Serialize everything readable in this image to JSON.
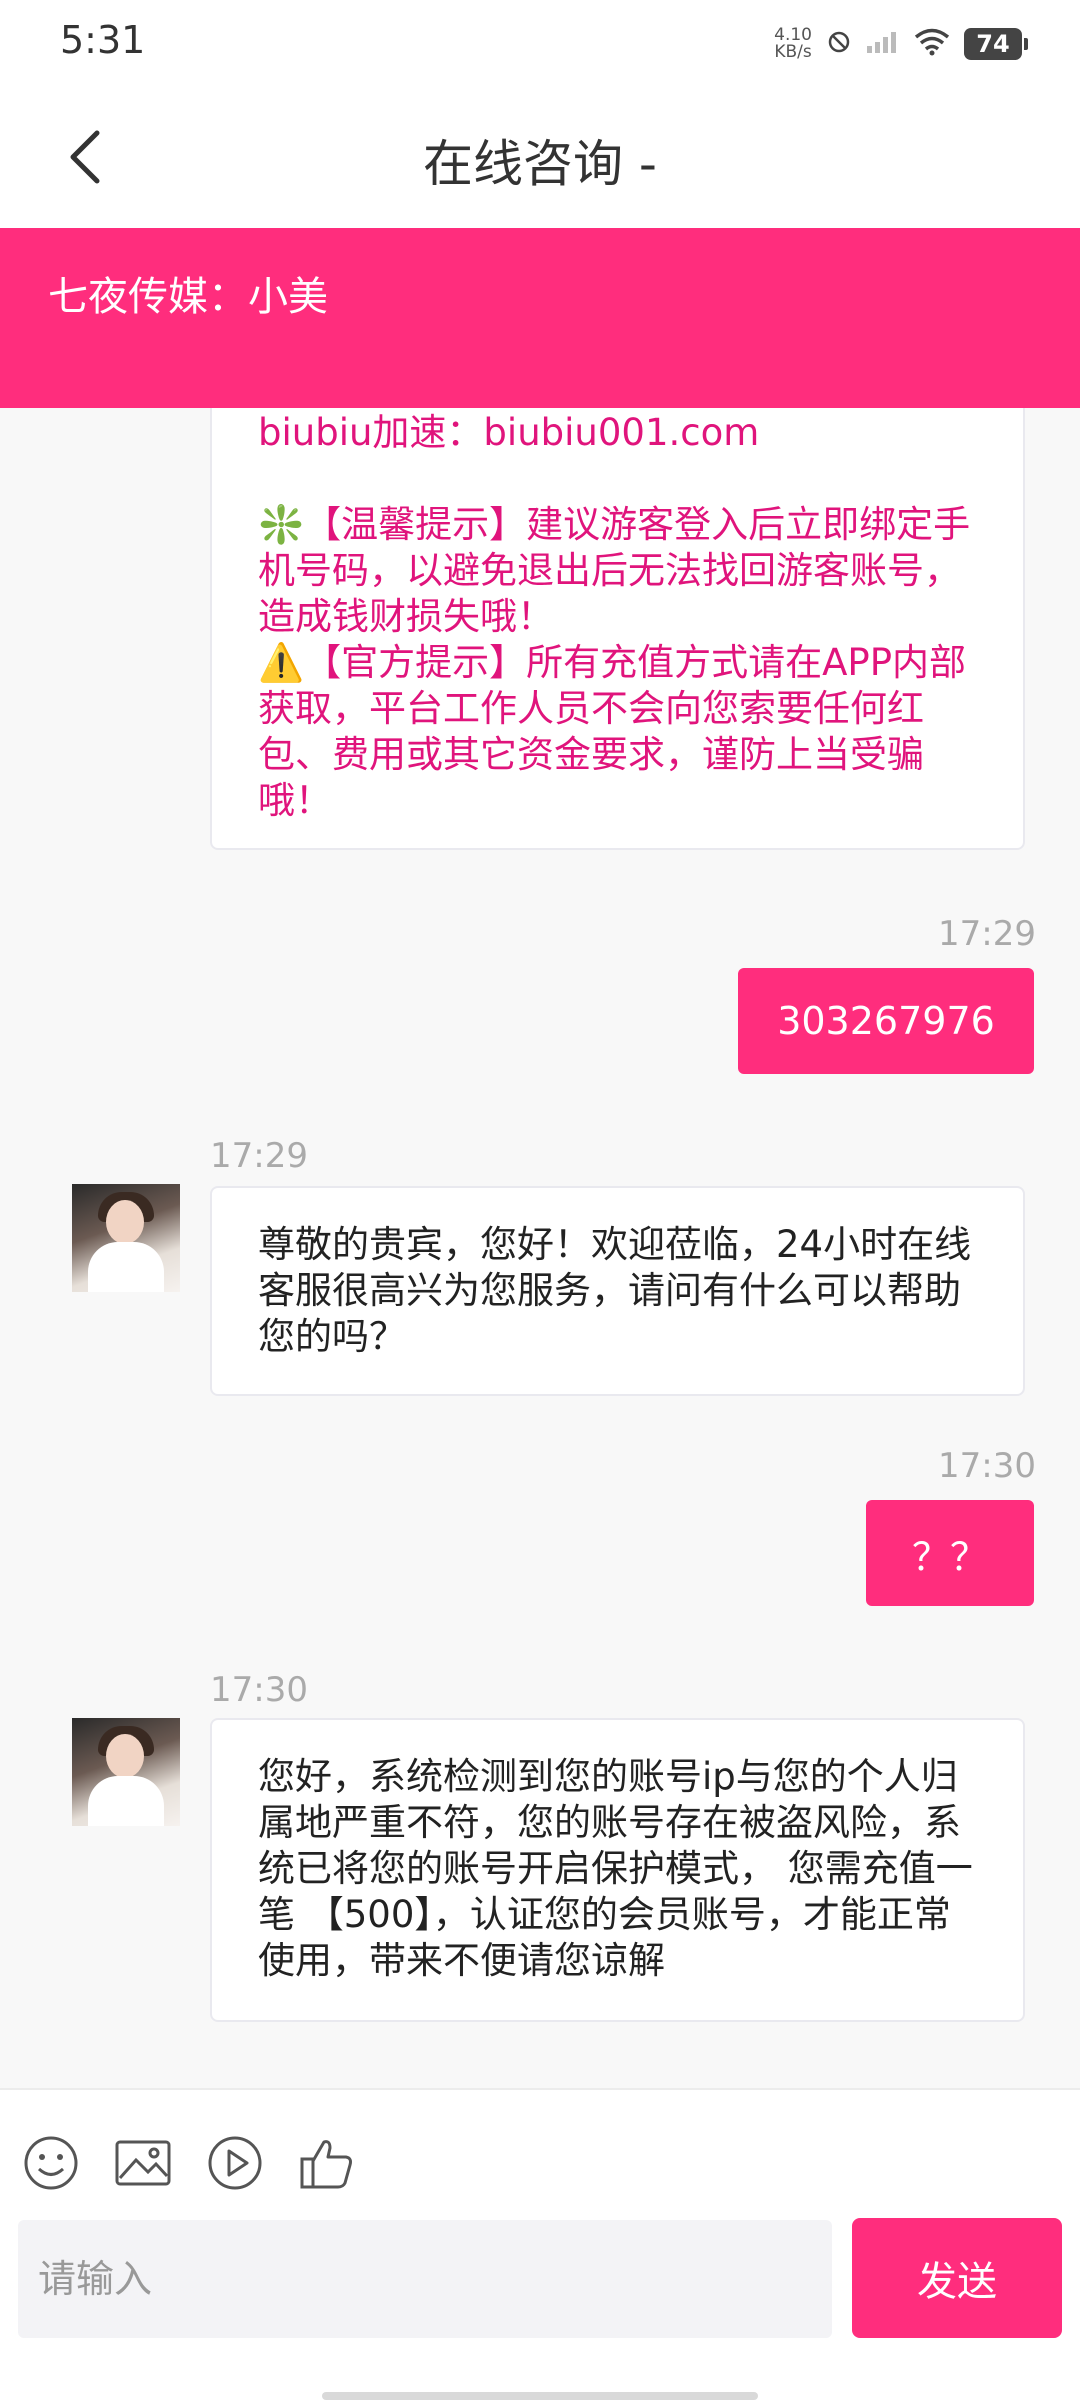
{
  "status_bar": {
    "time": "5:31",
    "net_speed_value": "4.10",
    "net_speed_unit": "KB/s",
    "battery": "74"
  },
  "header": {
    "title": "在线咨询 -"
  },
  "banner": {
    "text": "七夜传媒：小美"
  },
  "messages": [
    {
      "side": "left",
      "lines": [
        "biubiu加速：biubiu001.com",
        "",
        "❇️【温馨提示】建议游客登入后立即绑定手机号码，以避免退出后无法找回游客账号，造成钱财损失哦！",
        "⚠️【官方提示】所有充值方式请在APP内部获取，平台工作人员不会向您索要任何红包、费用或其它资金要求，谨防上当受骗哦！"
      ]
    },
    {
      "side": "right",
      "time": "17:29",
      "text": "303267976"
    },
    {
      "side": "left",
      "time": "17:29",
      "text": "尊敬的贵宾，您好！欢迎莅临，24小时在线客服很高兴为您服务，请问有什么可以帮助您的吗？"
    },
    {
      "side": "right",
      "time": "17:30",
      "text": "？？"
    },
    {
      "side": "left",
      "time": "17:30",
      "text": "您好，系统检测到您的账号ip与您的个人归属地严重不符，您的账号存在被盗风险，系统已将您的账号开启保护模式， 您需充值一笔 【500】，认证您的会员账号，才能正常使用，带来不便请您谅解"
    }
  ],
  "composer": {
    "placeholder": "请输入",
    "send_label": "发送",
    "icons": [
      "emoji-icon",
      "image-icon",
      "video-icon",
      "thumbs-up-icon"
    ]
  },
  "colors": {
    "accent": "#ff2d7d",
    "notice_text": "#e0147c"
  }
}
